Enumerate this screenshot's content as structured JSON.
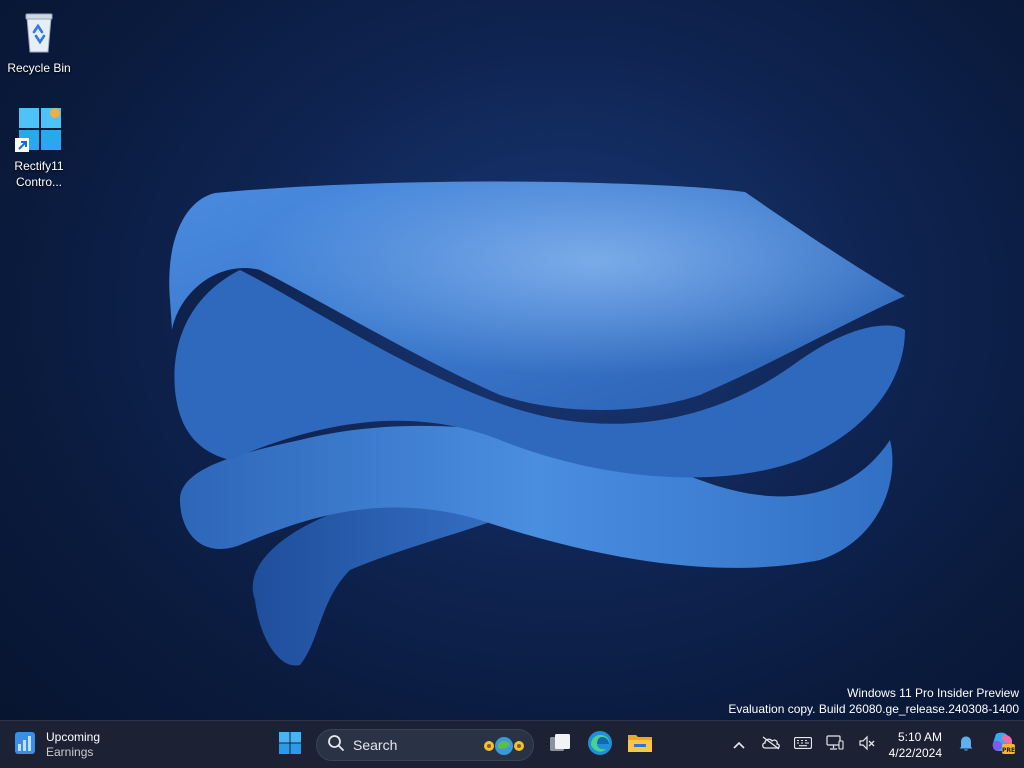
{
  "desktop": {
    "icons": [
      {
        "label": "Recycle Bin",
        "icon": "recycle-bin-icon"
      },
      {
        "label": "Rectify11 Contro...",
        "icon": "control-panel-icon"
      }
    ]
  },
  "watermark": {
    "line1": "Windows 11 Pro Insider Preview",
    "line2": "Evaluation copy. Build 26080.ge_release.240308-1400"
  },
  "taskbar": {
    "widget": {
      "title": "Upcoming",
      "subtitle": "Earnings",
      "icon": "stock-chart-icon"
    },
    "search": {
      "placeholder": "Search"
    },
    "pinned": [
      "start-icon",
      "task-view-icon",
      "edge-icon",
      "file-explorer-icon"
    ],
    "tray": {
      "icons": [
        "chevron-up-icon",
        "onedrive-offline-icon",
        "keyboard-icon",
        "network-icon",
        "volume-muted-icon",
        "notification-bell-icon",
        "copilot-icon"
      ],
      "time": "5:10 AM",
      "date": "4/22/2024"
    }
  },
  "colors": {
    "taskbar": "#1c2233",
    "accent": "#3a7fd5",
    "background": "#0f2452"
  }
}
